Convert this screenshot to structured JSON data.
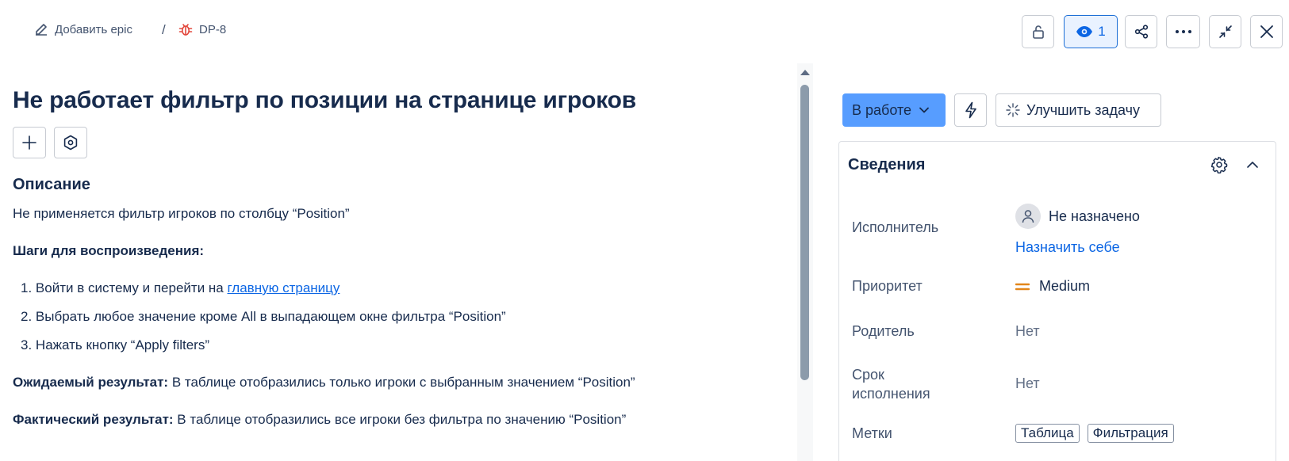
{
  "breadcrumb": {
    "add_epic": "Добавить epic",
    "separator": "/",
    "issue_key": "DP-8"
  },
  "toolbar": {
    "watch_count": "1"
  },
  "issue": {
    "title": "Не работает фильтр по позиции на странице игроков",
    "description_heading": "Описание",
    "description_line": "Не применяется фильтр игроков по столбцу “Position”",
    "steps_heading": "Шаги для воспроизведения:",
    "steps": [
      {
        "num": "1.",
        "text": "Войти в систему и перейти на ",
        "link": "главную страницу"
      },
      {
        "num": "2.",
        "text": "Выбрать любое значение кроме All в выпадающем окне фильтра “Position”"
      },
      {
        "num": "3.",
        "text": "Нажать кнопку “Apply filters”"
      }
    ],
    "expected_label": "Ожидаемый результат:",
    "expected_text": " В таблице отобразились только игроки с выбранным значением “Position”",
    "actual_label": "Фактический результат:",
    "actual_text": " В таблице отобразились все игроки без фильтра по значению “Position”"
  },
  "actions": {
    "status": "В работе",
    "improve": "Улучшить задачу"
  },
  "details": {
    "heading": "Сведения",
    "assignee_label": "Исполнитель",
    "assignee_value": "Не назначено",
    "assign_self": "Назначить себе",
    "priority_label": "Приоритет",
    "priority_value": "Medium",
    "parent_label": "Родитель",
    "parent_value": "Нет",
    "due_label_1": "Срок",
    "due_label_2": "исполнения",
    "due_value": "Нет",
    "labels_label": "Метки",
    "labels": [
      "Таблица",
      "Фильтрация"
    ]
  },
  "colors": {
    "accent": "#0c66e4",
    "status_bg": "#579dff",
    "bug_icon": "#e2483d",
    "priority_medium": "#e2861a"
  },
  "icons": {
    "edit": "edit-icon",
    "bug": "bug-icon",
    "unlock": "unlock-icon",
    "eye": "eye-icon",
    "share": "share-icon",
    "more": "more-icon",
    "collapse": "collapse-icon",
    "close": "close-icon",
    "add": "plus-icon",
    "apps": "apps-icon",
    "bolt": "bolt-icon",
    "sparkle": "sparkle-icon",
    "gear": "gear-icon",
    "chevron_up": "chevron-up-icon",
    "user": "user-icon",
    "priority": "priority-medium-icon"
  }
}
